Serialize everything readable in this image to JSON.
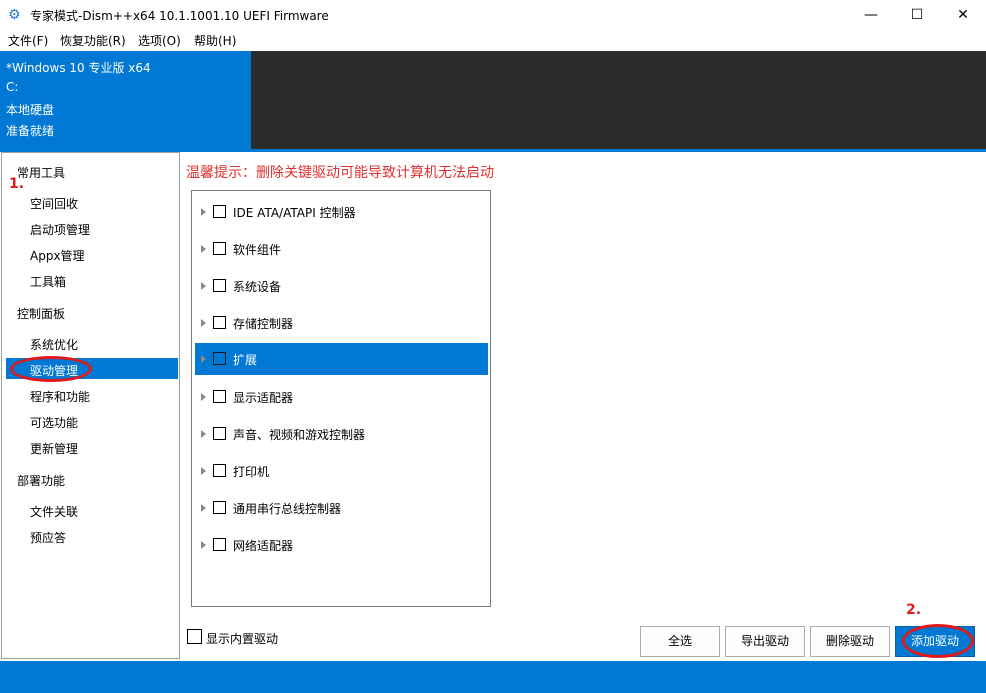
{
  "window": {
    "title": "专家模式-Dism++x64 10.1.1001.10 UEFI Firmware",
    "minimize_glyph": "—",
    "maximize_glyph": "☐",
    "close_glyph": "✕",
    "icon": "gear-icon"
  },
  "menu": [
    "文件(F)",
    "恢复功能(R)",
    "选项(O)",
    "帮助(H)"
  ],
  "info": {
    "os": "*Windows 10 专业版 x64",
    "drive": "C:",
    "disk_type": "本地硬盘",
    "status": "准备就绪"
  },
  "sidebar": {
    "groups": [
      {
        "heading": "常用工具",
        "items": [
          "空间回收",
          "启动项管理",
          "Appx管理",
          "工具箱"
        ]
      },
      {
        "heading": "控制面板",
        "items": [
          "系统优化",
          "驱动管理",
          "程序和功能",
          "可选功能",
          "更新管理"
        ]
      },
      {
        "heading": "部署功能",
        "items": [
          "文件关联",
          "预应答"
        ]
      }
    ],
    "selected": "驱动管理"
  },
  "main": {
    "warning": "温馨提示：删除关键驱动可能导致计算机无法启动",
    "tree": [
      "IDE ATA/ATAPI 控制器",
      "软件组件",
      "系统设备",
      "存储控制器",
      "扩展",
      "显示适配器",
      "声音、视频和游戏控制器",
      "打印机",
      "通用串行总线控制器",
      "网络适配器"
    ],
    "tree_selected": "扩展",
    "show_builtin_label": "显示内置驱动"
  },
  "buttons": {
    "select_all": "全选",
    "export": "导出驱动",
    "delete": "删除驱动",
    "add": "添加驱动"
  },
  "annotations": {
    "step1": "1.",
    "step2": "2."
  },
  "colors": {
    "accent": "#0178d4",
    "dark": "#2b2b2b",
    "annotation": "#e01a1a",
    "warning": "#e03030"
  }
}
